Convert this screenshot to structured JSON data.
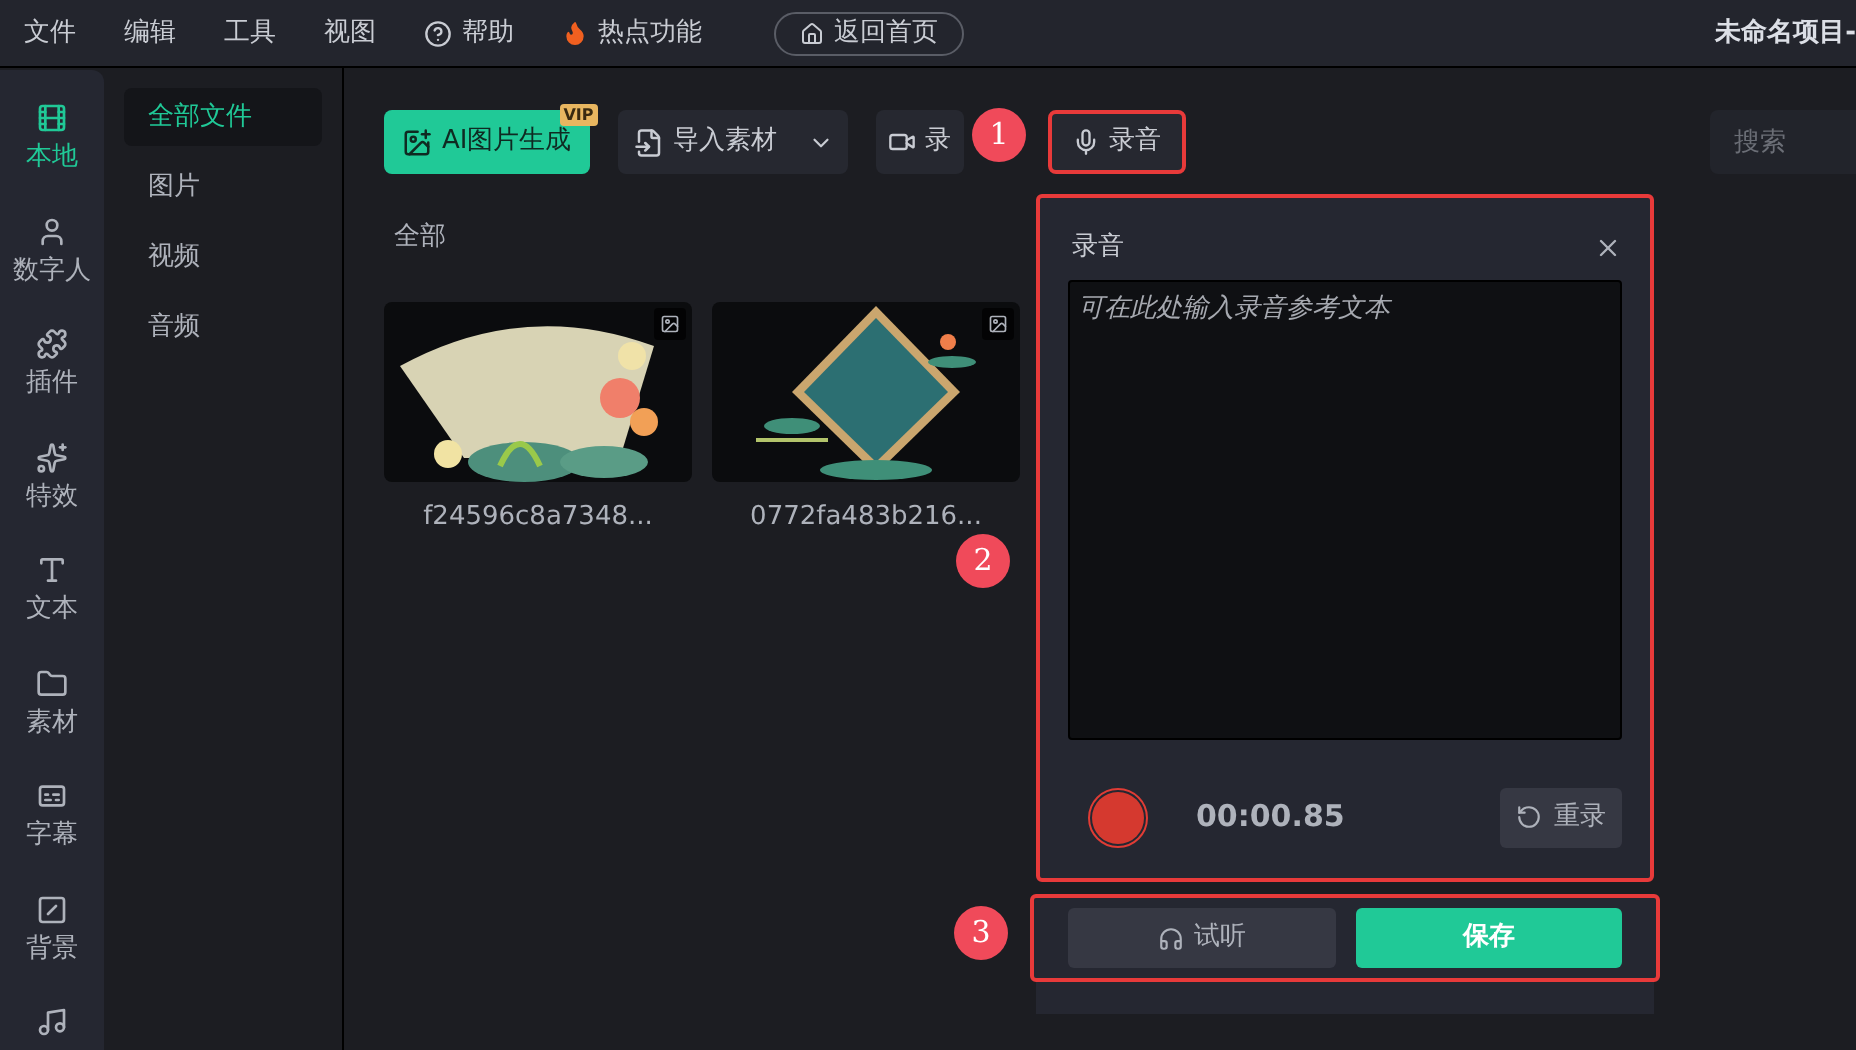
{
  "menu": [
    {
      "label": "文件",
      "kind": "text"
    },
    {
      "label": "编辑",
      "kind": "text"
    },
    {
      "label": "工具",
      "kind": "text"
    },
    {
      "label": "视图",
      "kind": "text"
    },
    {
      "label": "帮助",
      "kind": "help"
    },
    {
      "label": "热点功能",
      "kind": "hot"
    },
    {
      "label": "返回首页",
      "kind": "home"
    }
  ],
  "project_title": "未命名项目-",
  "rail": [
    {
      "label": "本地",
      "selected": true
    },
    {
      "label": "数字人",
      "selected": false
    },
    {
      "label": "插件",
      "selected": false
    },
    {
      "label": "特效",
      "selected": false
    },
    {
      "label": "文本",
      "selected": false
    },
    {
      "label": "素材",
      "selected": false
    },
    {
      "label": "字幕",
      "selected": false
    },
    {
      "label": "背景",
      "selected": false
    },
    {
      "selected": false
    }
  ],
  "categories": [
    {
      "label": "全部文件",
      "selected": true
    },
    {
      "label": "图片",
      "selected": false
    },
    {
      "label": "视频",
      "selected": false
    },
    {
      "label": "音频",
      "selected": false
    }
  ],
  "toolbar": [
    {
      "kind": "ai",
      "label": "AI图片生成",
      "badge": "VIP",
      "highlighted": false
    },
    {
      "kind": "import",
      "label": "导入素材",
      "highlighted": false
    },
    {
      "kind": "screen",
      "label": "录",
      "highlighted": false
    },
    {
      "kind": "record",
      "label": "录音",
      "highlighted": true
    }
  ],
  "search": {
    "placeholder": "搜索"
  },
  "section_title": "全部",
  "files": [
    {
      "name": "f24596c8a7348...",
      "kind": "picture"
    },
    {
      "name": "0772fa483b216...",
      "kind": "picture"
    }
  ],
  "record_panel": {
    "title": "录音",
    "placeholder": "可在此处输入录音参考文本",
    "time": "00:00.85",
    "recording": true,
    "rerecord": "重录",
    "preview": "试听",
    "save": "保存",
    "highlighted": true,
    "actions_highlighted": true
  },
  "annotations": [
    "1",
    "2",
    "3"
  ]
}
